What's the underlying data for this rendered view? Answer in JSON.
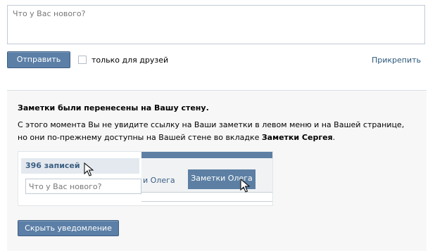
{
  "composer": {
    "placeholder": "Что у Вас нового?"
  },
  "actions": {
    "send_label": "Отправить",
    "friends_only_label": "только для друзей",
    "friends_only_checked": false,
    "attach_label": "Прикрепить"
  },
  "notice": {
    "title": "Заметки были перенесены на Вашу стену.",
    "text_part1": "С этого момента Вы не увидите ссылку на Ваши заметки в левом меню и на Вашей странице, но они по-прежнему доступны на Вашей стене во вкладке ",
    "text_bold": "Заметки Сергея",
    "text_end": ".",
    "hide_label": "Скрыть уведомление"
  },
  "illustration": {
    "records_count": "396 записей",
    "input_placeholder": "Что у Вас нового?",
    "tab_partial": "и Олега",
    "tab_active": "Заметки Олега",
    "icons": [
      "cursor-arrow-icon",
      "cursor-arrow-icon"
    ]
  },
  "colors": {
    "button": "#5b7fa6",
    "link": "#2b587a",
    "notice_bg": "#f7f7f7",
    "tab_active": "#5c7fa3"
  }
}
